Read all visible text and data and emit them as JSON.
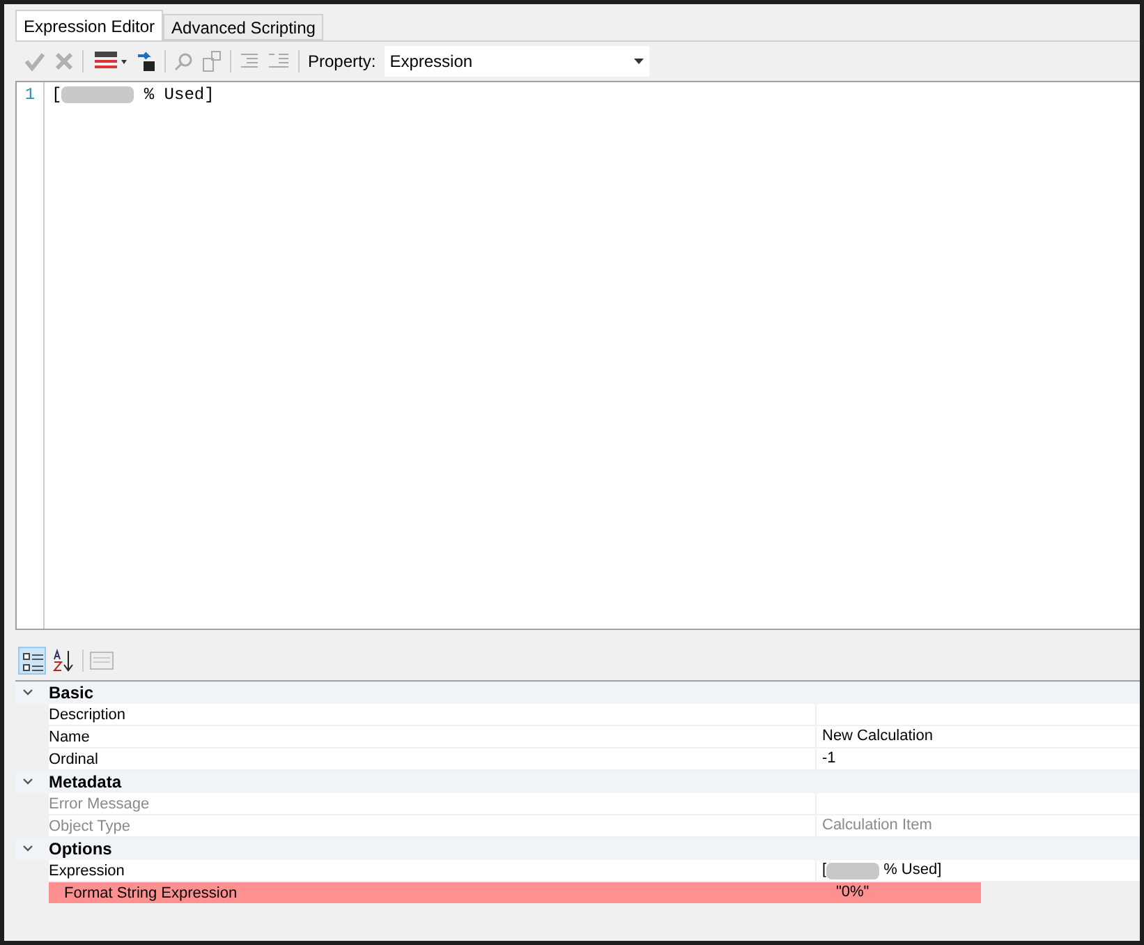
{
  "tabs": [
    {
      "label": "Expression Editor",
      "selected": true
    },
    {
      "label": "Advanced Scripting",
      "selected": false
    }
  ],
  "toolbar": {
    "property_label": "Property:",
    "property_value": "Expression"
  },
  "editor": {
    "lines": [
      {
        "number": "1",
        "prefix": "[",
        "redacted": true,
        "suffix": " % Used]"
      }
    ]
  },
  "property_grid": {
    "categories": [
      {
        "name": "Basic",
        "expanded": true,
        "rows": [
          {
            "name": "Description",
            "value": "",
            "disabled": false,
            "highlighted": false
          },
          {
            "name": "Name",
            "value": "New Calculation",
            "disabled": false,
            "highlighted": false
          },
          {
            "name": "Ordinal",
            "value": "-1",
            "disabled": false,
            "highlighted": false
          }
        ]
      },
      {
        "name": "Metadata",
        "expanded": true,
        "rows": [
          {
            "name": "Error Message",
            "value": "",
            "disabled": true,
            "highlighted": false
          },
          {
            "name": "Object Type",
            "value": "Calculation Item",
            "disabled": true,
            "highlighted": false
          }
        ]
      },
      {
        "name": "Options",
        "expanded": true,
        "rows": [
          {
            "name": "Expression",
            "value_prefix": "[",
            "redacted": true,
            "value": "% Used]",
            "disabled": false,
            "highlighted": false
          },
          {
            "name": "Format String Expression",
            "value": "\"0%\"",
            "disabled": false,
            "highlighted": true
          }
        ]
      }
    ]
  }
}
